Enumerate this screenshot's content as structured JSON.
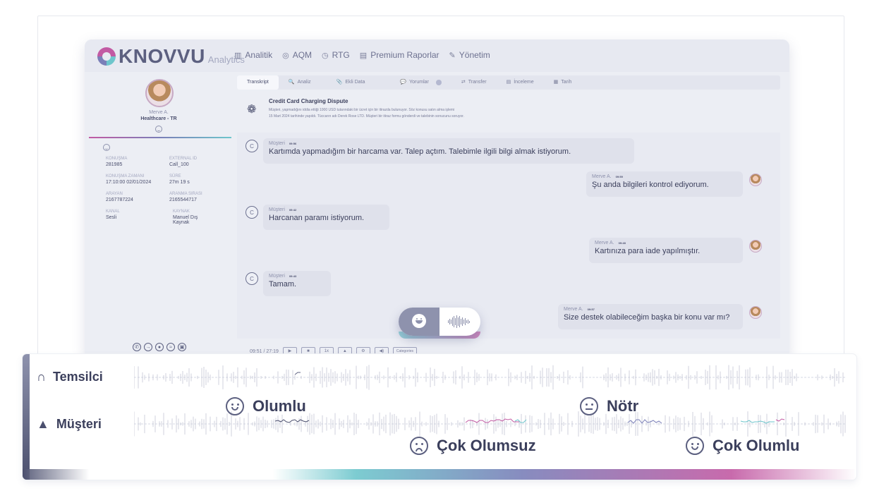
{
  "app": {
    "brand": "KNOVVU",
    "brand_sub": "Analytics"
  },
  "nav": [
    {
      "label": "Analitik",
      "icon": "chart-icon"
    },
    {
      "label": "AQM",
      "icon": "target-icon"
    },
    {
      "label": "RTG",
      "icon": "clock-icon"
    },
    {
      "label": "Premium Raporlar",
      "icon": "report-icon"
    },
    {
      "label": "Yönetim",
      "icon": "pen-icon"
    }
  ],
  "agent": {
    "name": "Merve A.",
    "team": "Healthcare - TR"
  },
  "info": [
    [
      {
        "label": "KONUŞMA",
        "value": "281985"
      },
      {
        "label": "EXTERNAL ID",
        "value": "Call_100"
      }
    ],
    [
      {
        "label": "KONUŞMA ZAMANI",
        "value": "17:10:00  02/01/2024"
      },
      {
        "label": "SÜRE",
        "value": "27m 19 s"
      }
    ],
    [
      {
        "label": "ARAYAN",
        "value": "2167787224"
      },
      {
        "label": "ARANMA SIRASI",
        "value": "2165544717"
      }
    ],
    [
      {
        "label": "KANAL",
        "value": "Sesli"
      },
      {
        "label": "KAYNAK",
        "value": "Manuel Dış Kaynak"
      }
    ]
  ],
  "tabs": [
    {
      "label": "Transkript",
      "icon": ""
    },
    {
      "label": "Analiz",
      "icon": "🔍"
    },
    {
      "label": "Ekli Data",
      "icon": "📎"
    },
    {
      "label": "Yorumlar",
      "icon": "💬"
    },
    {
      "label": "Transfer",
      "icon": "⇄"
    },
    {
      "label": "İnceleme",
      "icon": "▤"
    },
    {
      "label": "Tarih",
      "icon": "▦"
    }
  ],
  "summary": {
    "title": "Credit Card Charging Dispute",
    "line1": "Müşteri, yapmadığını iddia ettiği 1000 USD tutarındaki bir ücret için bir itirazda bulunuyor. Söz konusu satın alma işlemi",
    "line2": "15 Mart 2024 tarihinde yapıldı. Tüccarın adı Derek Rose LTD. Müşteri bir itiraz formu gönderdi ve talebinin sonucunu soruyor."
  },
  "messages": [
    {
      "side": "customer",
      "sender": "Müşteri",
      "time": "09:56",
      "text": "Kartımda yapmadığım bir harcama var. Talep açtım. Talebimle ilgili bilgi almak istiyorum."
    },
    {
      "side": "agent",
      "sender": "Merve A.",
      "time": "09:59",
      "text": "Şu anda bilgileri kontrol ediyorum."
    },
    {
      "side": "customer",
      "sender": "Müşteri",
      "time": "09:42",
      "text": "Harcanan paramı istiyorum."
    },
    {
      "side": "agent",
      "sender": "Merve A.",
      "time": "09:48",
      "text": "Kartınıza para iade yapılmıştır."
    },
    {
      "side": "customer",
      "sender": "Müşteri",
      "time": "09:43",
      "text": "Tamam."
    },
    {
      "side": "agent",
      "sender": "Merve A.",
      "time": "09:57",
      "text": "Size destek olabileceğim başka bir konu var mı?"
    }
  ],
  "player": {
    "time": "09:51 / 27:19",
    "speed": "1x",
    "select": "Categories"
  },
  "customer_initial": "C",
  "waveform": {
    "rows": [
      {
        "label": "Temsilci",
        "icon": "headphones-icon"
      },
      {
        "label": "Müşteri",
        "icon": "person-icon"
      }
    ],
    "sentiments": [
      {
        "label": "Olumlu",
        "face": "smile"
      },
      {
        "label": "Nötr",
        "face": "neutral"
      },
      {
        "label": "Çok Olumsuz",
        "face": "sad"
      },
      {
        "label": "Çok Olumlu",
        "face": "smile"
      }
    ]
  },
  "colors": {
    "accent_pink": "#c25aa3",
    "accent_teal": "#6ec6cc",
    "accent_violet": "#7a7fb8",
    "text_dark": "#3b3f5c"
  }
}
